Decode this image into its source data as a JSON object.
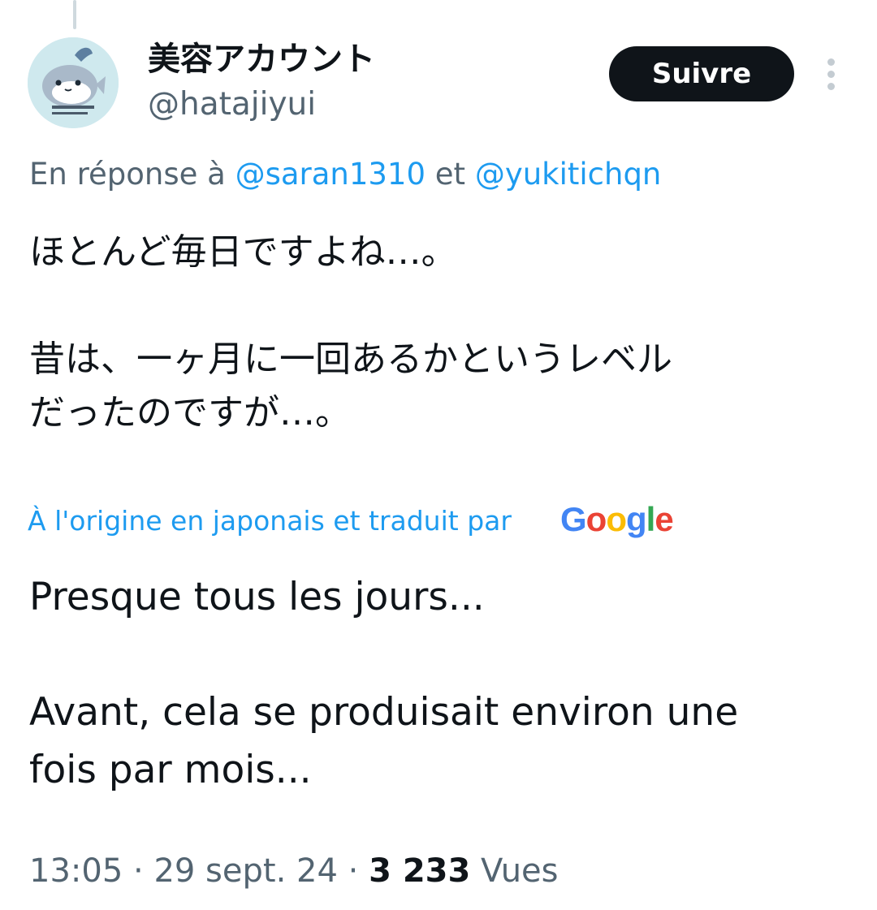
{
  "author": {
    "display_name": "美容アカウント",
    "handle": "@hatajiyui",
    "avatar_icon": "shark-avatar-icon"
  },
  "follow_label": "Suivre",
  "reply": {
    "prefix": "En réponse à ",
    "mention_1": "@saran1310",
    "connector": " et ",
    "mention_2": "@yukitichqn"
  },
  "tweet": {
    "original_text": "ほとんど毎日ですよね…。\n\n昔は、一ヶ月に一回あるかというレベル\nだったのですが…。",
    "translation_note": "À l'origine en japonais et traduit par",
    "translation_provider": "Google",
    "translated_text": "Presque tous les jours...\n\nAvant, cela se produisait environ une\nfois par mois..."
  },
  "meta": {
    "time": "13:05",
    "separator": " · ",
    "date": "29 sept. 24",
    "views_count": "3 233",
    "views_label": " Vues"
  },
  "colors": {
    "accent": "#1d9bf0",
    "secondary_text": "#536471",
    "primary_text": "#0f1419",
    "google_blue": "#4285F4",
    "google_red": "#EA4335",
    "google_yellow": "#FBBC05",
    "google_green": "#34A853"
  }
}
